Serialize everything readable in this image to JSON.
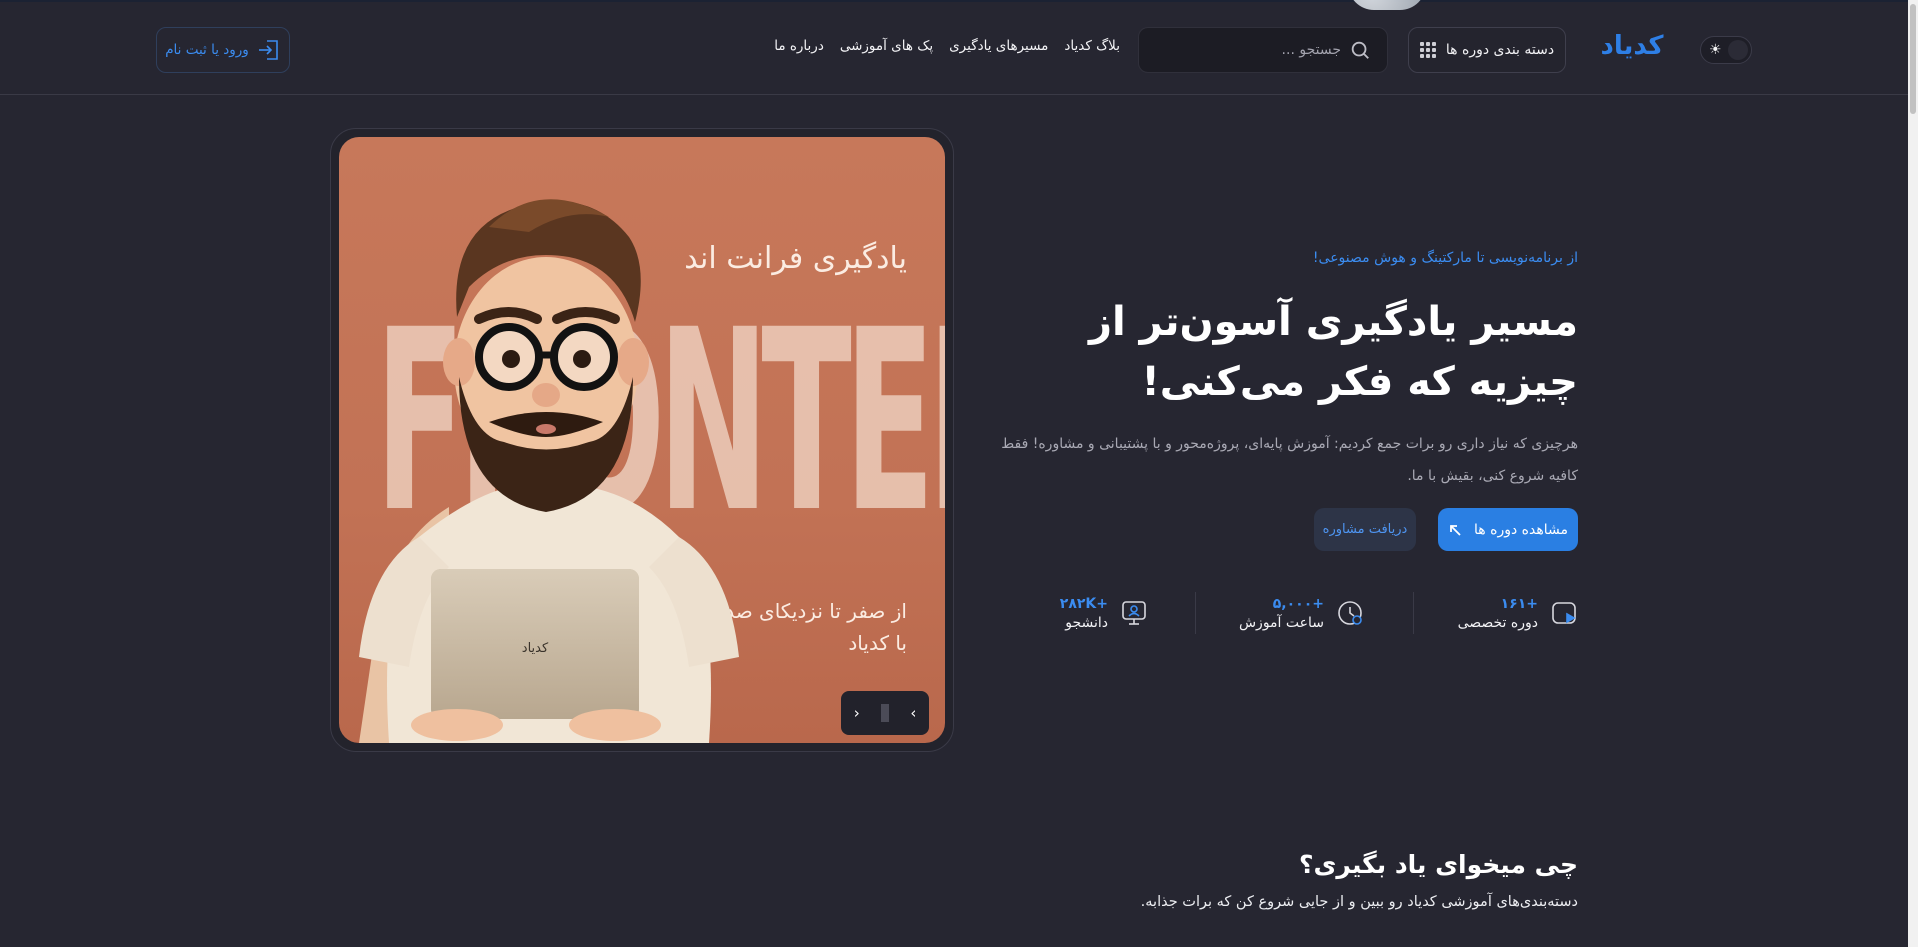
{
  "header": {
    "logo_text": "کدیاد",
    "category_button": "دسته بندی دوره ها",
    "search_placeholder": "جستجو ...",
    "nav": [
      "بلاگ کدیاد",
      "مسیرهای یادگیری",
      "پک های آموزشی",
      "درباره ما"
    ],
    "login_label": "ورود یا ثبت نام"
  },
  "hero_slide": {
    "title": "یادگیری فرانت اند",
    "big_word": "FRONTEND",
    "subtitle_line1": "از صفر تا نزدیکای صد",
    "subtitle_line2": "با کدیاد",
    "laptop_logo": "کدیاد"
  },
  "hero": {
    "tagline": "از برنامه‌نویسی تا مارکتینگ و هوش مصنوعی!",
    "headline": "مسیر یادگیری آسون‌تر از چیزیه که فکر می‌کنی!",
    "description": "هرچیزی که نیاز داری رو برات جمع کردیم: آموزش پایه‌ای، پروژه‌محور و با پشتیبانی و مشاوره! فقط کافیه شروع کنی، بقیش با ما.",
    "primary_button": "مشاهده دوره ها",
    "secondary_button": "دریافت مشاوره",
    "stats": [
      {
        "value": "+۱۶۱",
        "label": "دوره تخصصی",
        "icon": "video-course-icon"
      },
      {
        "value": "+۵,۰۰۰",
        "label": "ساعت آموزش",
        "icon": "clock-icon"
      },
      {
        "value": "+۲۸۲K",
        "label": "دانشجو",
        "icon": "student-monitor-icon"
      }
    ]
  },
  "section": {
    "title": "چی میخوای یاد بگیری؟",
    "subtitle": "دسته‌بندی‌های آموزشی کدیاد رو ببین و از جایی شروع کن که برات جذابه."
  },
  "colors": {
    "background": "#262631",
    "accent": "#2a7fe3",
    "slide_bg": "#c7785a"
  }
}
